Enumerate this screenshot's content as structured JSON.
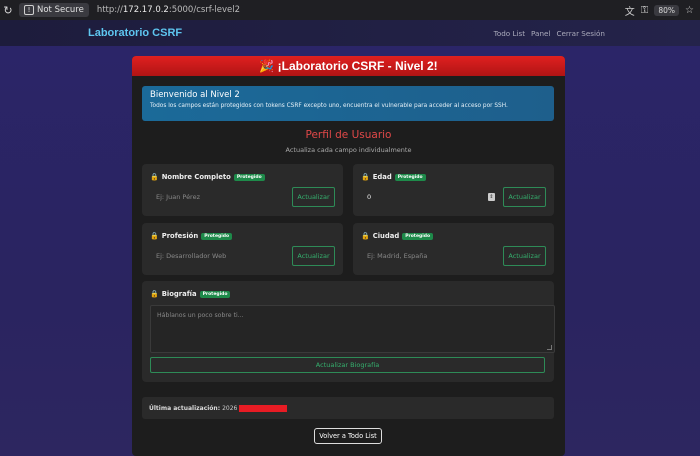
{
  "browser": {
    "security_label": "Not Secure",
    "url_prefix": "http://",
    "url_host": "172.17.0.2",
    "url_path": ":5000/csrf-level2",
    "zoom": "80%"
  },
  "navbar": {
    "brand": "Laboratorio CSRF",
    "links": [
      "Todo List",
      "Panel",
      "Cerrar Sesión"
    ]
  },
  "header": {
    "title": "🎉 ¡Laboratorio CSRF - Nivel 2!"
  },
  "alert": {
    "title": "Bienvenido al Nivel 2",
    "text": "Todos los campos están protegidos con tokens CSRF excepto uno, encuentra el vulnerable para acceder al acceso por SSH."
  },
  "profile": {
    "title": "Perfil de Usuario",
    "subtitle": "Actualiza cada campo individualmente"
  },
  "fields": {
    "nombre": {
      "label": "Nombre Completo",
      "badge": "Protegido",
      "placeholder": "Ej: Juan Pérez",
      "button": "Actualizar"
    },
    "edad": {
      "label": "Edad",
      "badge": "Protegido",
      "value": "0",
      "button": "Actualizar"
    },
    "profesion": {
      "label": "Profesión",
      "badge": "Protegido",
      "placeholder": "Ej: Desarrollador Web",
      "button": "Actualizar"
    },
    "ciudad": {
      "label": "Ciudad",
      "badge": "Protegido",
      "placeholder": "Ej: Madrid, España",
      "button": "Actualizar"
    },
    "biografia": {
      "label": "Biografía",
      "badge": "Protegido",
      "placeholder": "Háblanos un poco sobre ti...",
      "button": "Actualizar Biografía"
    }
  },
  "last_update": {
    "label": "Última actualización:",
    "value": "2026"
  },
  "back_button": "Volver a Todo List",
  "colors": {
    "accent_red": "#e02020",
    "brand_blue": "#5ec6f0",
    "protected_green": "#1e8a4a",
    "button_green": "#35b06e",
    "alert_blue": "#1b6a99"
  },
  "icons": {
    "lock": "lock-icon",
    "security_warning": "warning-icon"
  }
}
